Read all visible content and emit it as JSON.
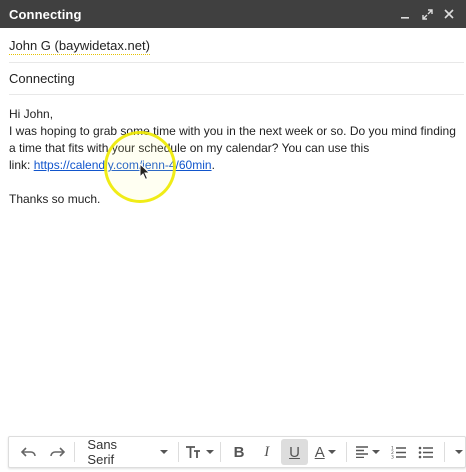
{
  "window": {
    "title": "Connecting",
    "controls": [
      "minimize-icon",
      "expand-icon",
      "close-icon"
    ]
  },
  "compose": {
    "to": "John G (baywidetax.net)",
    "subject": "Connecting",
    "body": {
      "greeting": "Hi John,",
      "line1": "I was hoping to grab some time with you in the next week or so. Do you mind finding a time that fits with your schedule on my calendar? You can use this",
      "link_prefix": "link: ",
      "link_text": "https://calendly.com/jenn-4/60min",
      "link_suffix": ".",
      "closing": "Thanks so much."
    }
  },
  "toolbar": {
    "font": "Sans Serif",
    "items": [
      "undo-icon",
      "redo-icon",
      "font-select",
      "text-size-icon",
      "bold-icon",
      "italic-icon",
      "underline-icon",
      "text-color-icon",
      "align-icon",
      "numbered-list-icon",
      "bulleted-list-icon",
      "more-options-icon"
    ],
    "active": "underline"
  },
  "colors": {
    "titlebar": "#404040",
    "link": "#1155cc",
    "highlight_ring": "#eeea00"
  }
}
